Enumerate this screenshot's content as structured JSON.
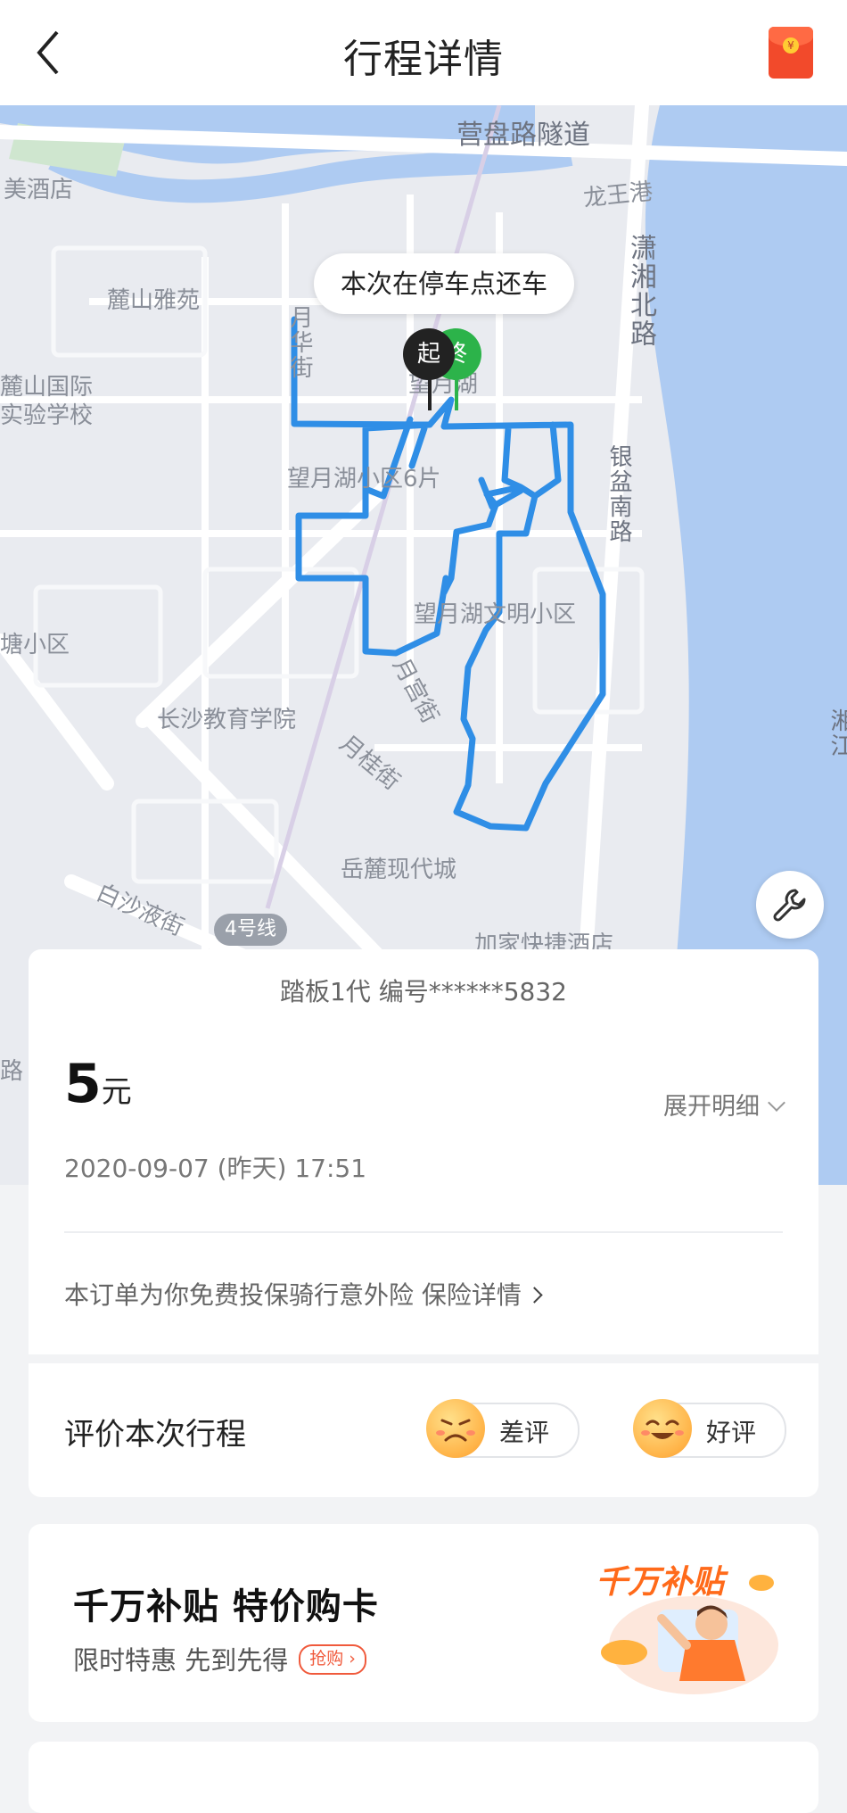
{
  "header": {
    "title": "行程详情",
    "back_icon": "chevron-left-icon",
    "action_icon": "red-packet-icon"
  },
  "map": {
    "tooltip": "本次在停车点还车",
    "start_marker": "起",
    "end_marker": "终",
    "labels": {
      "yingpan_tunnel": "营盘路隧道",
      "longwang_port": "龙王港",
      "hotel_top": "美酒店",
      "lushan_yayuan": "麓山雅苑",
      "yuehua_street": "月华街",
      "lushan_school": "麓山国际\n实验学校",
      "xiaoxiang_north": "潇湘北路",
      "wangyuehu_lake": "望月湖",
      "wangyuehu_block6": "望月湖小区6片",
      "yinpen_south": "银盆南路",
      "pond_community": "塘小区",
      "wenming_community": "望月湖文明小区",
      "education_college": "长沙教育学院",
      "yuegong_street": "月宫街",
      "yuegui_street": "月桂街",
      "yuelu_city": "岳麓现代城",
      "baisha_street": "白沙液街",
      "line4": "4号线",
      "jiajia_hotel": "加家快捷酒店",
      "xiang_river": "湘江",
      "road_left": "路"
    },
    "route_color": "#2f8ee6",
    "tool_icon": "wrench-icon"
  },
  "trip": {
    "vehicle": "踏板1代 编号******5832",
    "price": "5",
    "currency": "元",
    "expand_label": "展开明细",
    "time": "2020-09-07 (昨天) 17:51",
    "insurance_text": "本订单为你免费投保骑行意外险 保险详情"
  },
  "rating": {
    "label": "评价本次行程",
    "bad": "差评",
    "good": "好评"
  },
  "promo": {
    "title": "千万补贴 特价购卡",
    "subtitle": "限时特惠 先到先得",
    "tag": "抢购",
    "art_title": "千万补贴"
  },
  "colors": {
    "accent": "#f05a3c",
    "route": "#2f8ee6",
    "start_pin": "#222222",
    "end_pin": "#2cb34a"
  }
}
